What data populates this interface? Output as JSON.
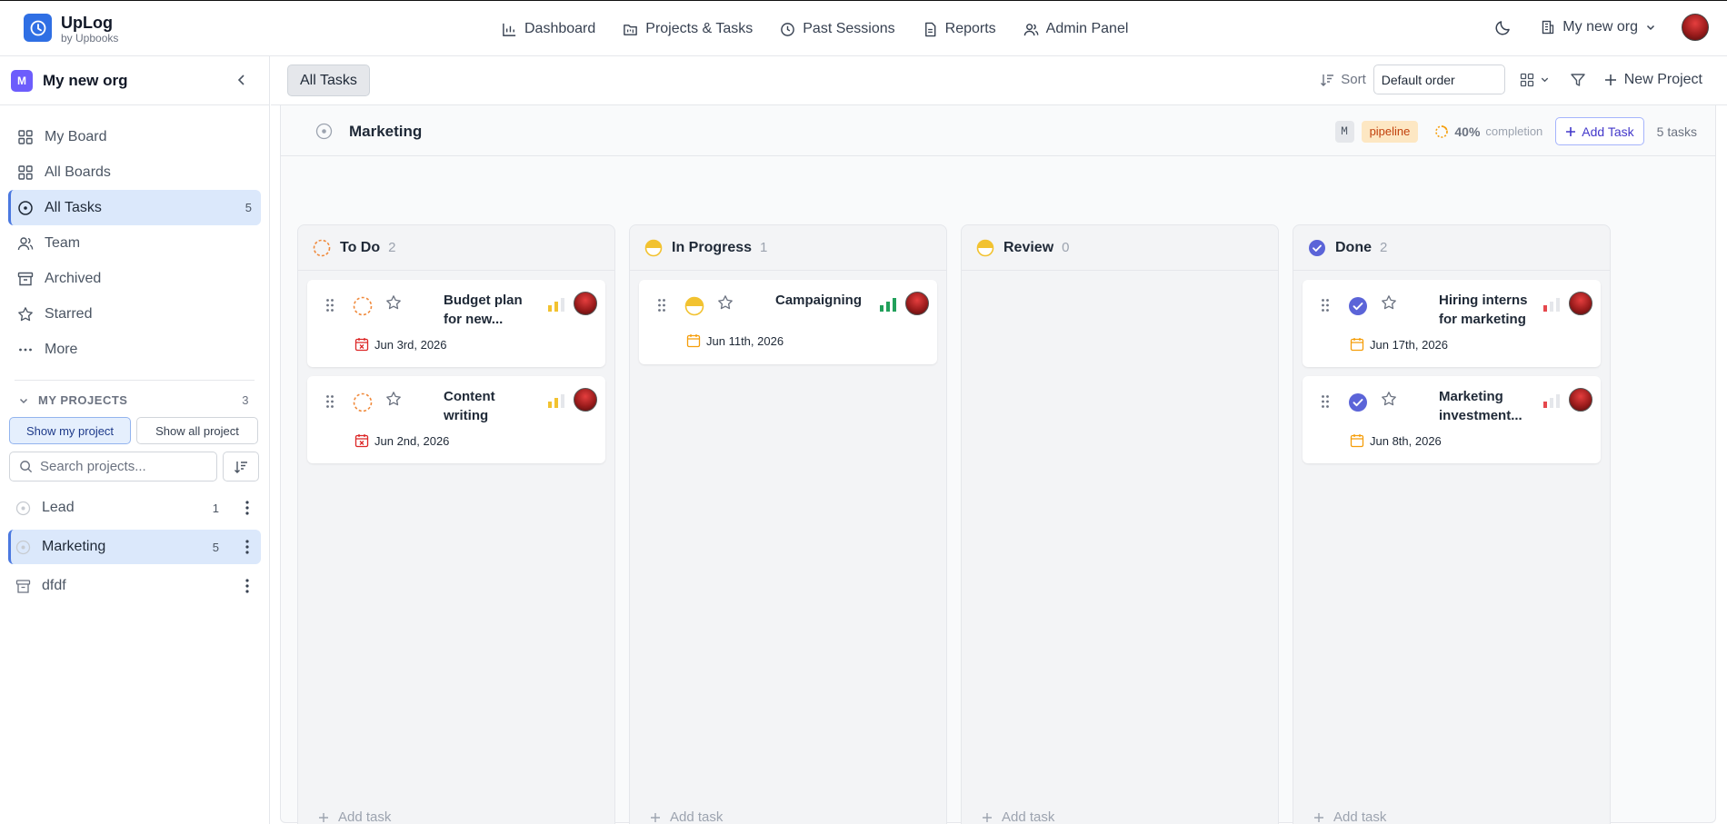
{
  "app": {
    "name": "UpLog",
    "subtitle": "by Upbooks",
    "accent": "#2f6fe4"
  },
  "nav": [
    {
      "label": "Dashboard",
      "icon": "bar-chart-icon"
    },
    {
      "label": "Projects & Tasks",
      "icon": "folder-kanban-icon"
    },
    {
      "label": "Past Sessions",
      "icon": "clock-icon"
    },
    {
      "label": "Reports",
      "icon": "file-text-icon"
    },
    {
      "label": "Admin Panel",
      "icon": "users-icon"
    }
  ],
  "org_switcher": {
    "label": "My new org"
  },
  "sidebar": {
    "org_badge": "M",
    "org_name": "My new org",
    "items": [
      {
        "label": "My Board",
        "count": ""
      },
      {
        "label": "All Boards",
        "count": ""
      },
      {
        "label": "All Tasks",
        "count": "5"
      },
      {
        "label": "Team",
        "count": ""
      },
      {
        "label": "Archived",
        "count": ""
      },
      {
        "label": "Starred",
        "count": ""
      },
      {
        "label": "More",
        "count": ""
      }
    ],
    "projects_heading": "MY PROJECTS",
    "projects_count": "3",
    "show_my": "Show my project",
    "show_all": "Show all project",
    "search_placeholder": "Search projects...",
    "projects": [
      {
        "name": "Lead",
        "count": "1"
      },
      {
        "name": "Marketing",
        "count": "5"
      },
      {
        "name": "dfdf",
        "count": ""
      }
    ]
  },
  "toolbar": {
    "tab": "All Tasks",
    "sort_label": "Sort",
    "sort_value": "Default order",
    "new_project": "New Project"
  },
  "project": {
    "name": "Marketing",
    "key": "M",
    "tag": "pipeline",
    "completion": "40%",
    "completion_label": "completion",
    "add_task": "Add Task",
    "task_count": "5 tasks"
  },
  "columns": [
    {
      "title": "To Do",
      "count": "2",
      "add": "Add task",
      "cards": [
        {
          "title": "Budget plan for new...",
          "date": "Jun 3rd, 2026",
          "overdue": true,
          "priority": "medium"
        },
        {
          "title": "Content writing",
          "date": "Jun 2nd, 2026",
          "overdue": true,
          "priority": "medium"
        }
      ]
    },
    {
      "title": "In Progress",
      "count": "1",
      "add": "Add task",
      "cards": [
        {
          "title": "Campaigning",
          "date": "Jun 11th, 2026",
          "overdue": false,
          "priority": "high"
        }
      ]
    },
    {
      "title": "Review",
      "count": "0",
      "add": "Add task",
      "cards": []
    },
    {
      "title": "Done",
      "count": "2",
      "add": "Add task",
      "cards": [
        {
          "title": "Hiring interns for marketing",
          "date": "Jun 17th, 2026",
          "overdue": false,
          "priority": "low"
        },
        {
          "title": "Marketing investment...",
          "date": "Jun 8th, 2026",
          "overdue": false,
          "priority": "low"
        }
      ]
    }
  ],
  "colors": {
    "todo": "#f08a3c",
    "in_progress": "#f2c230",
    "done": "#5b64d8",
    "overdue": "#dc2626",
    "due": "#f59e0b",
    "priority_medium": "#f2c230",
    "priority_high": "#22a05b",
    "priority_low": "#e5484d"
  }
}
